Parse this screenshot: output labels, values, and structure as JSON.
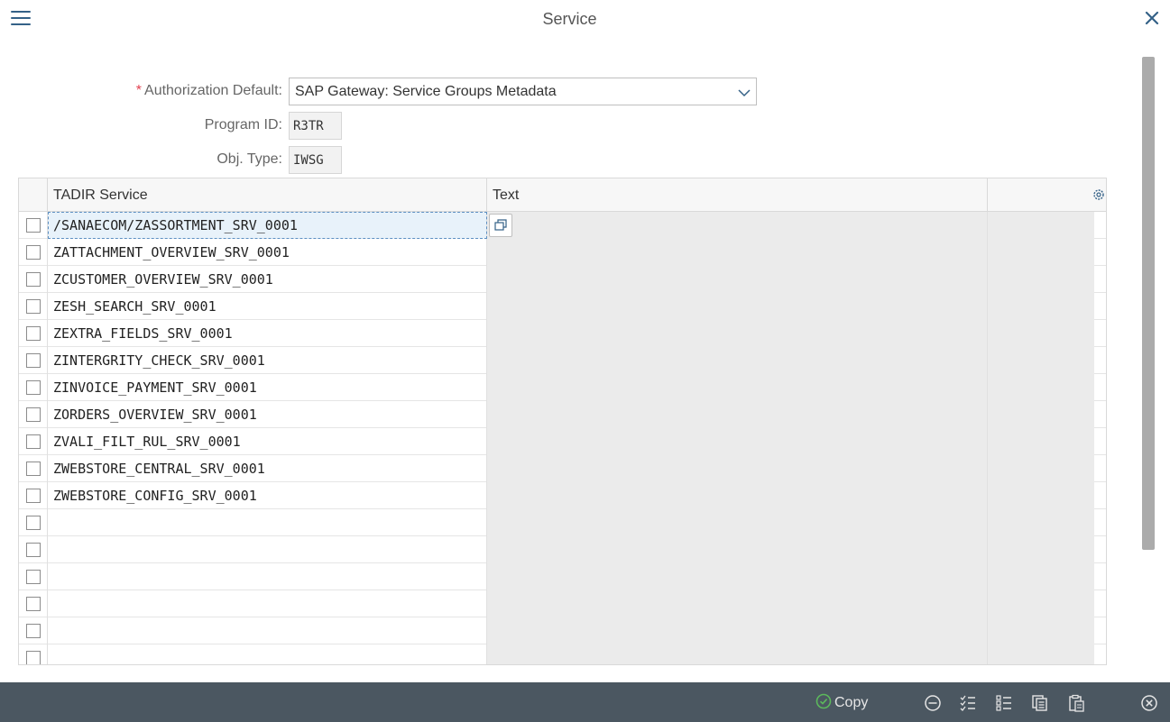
{
  "header": {
    "title": "Service"
  },
  "form": {
    "auth_label": "Authorization Default:",
    "auth_required": "*",
    "auth_value": "SAP Gateway: Service Groups Metadata",
    "program_label": "Program ID:",
    "program_value": "R3TR",
    "objtype_label": "Obj. Type:",
    "objtype_value": "IWSG"
  },
  "table": {
    "columns": [
      "TADIR Service",
      "Text"
    ],
    "rows": [
      "/SANAECOM/ZASSORTMENT_SRV_0001",
      "ZATTACHMENT_OVERVIEW_SRV_0001",
      "ZCUSTOMER_OVERVIEW_SRV_0001",
      "ZESH_SEARCH_SRV_0001",
      "ZEXTRA_FIELDS_SRV_0001",
      "ZINTERGRITY_CHECK_SRV_0001",
      "ZINVOICE_PAYMENT_SRV_0001",
      "ZORDERS_OVERVIEW_SRV_0001",
      "ZVALI_FILT_RUL_SRV_0001",
      "ZWEBSTORE_CENTRAL_SRV_0001",
      "ZWEBSTORE_CONFIG_SRV_0001",
      "",
      "",
      "",
      "",
      "",
      ""
    ]
  },
  "footer": {
    "copy_label": "Copy"
  },
  "colors": {
    "accent": "#346187",
    "footer_bg": "#4b5761",
    "required": "#e34352",
    "copy_check": "#5cb85c"
  }
}
